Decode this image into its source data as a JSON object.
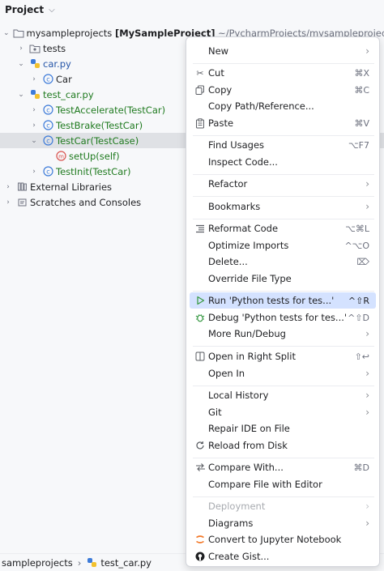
{
  "panel": {
    "title": "Project"
  },
  "tree": {
    "root": {
      "name": "mysampleprojects",
      "module": "[MySampleProject]",
      "path": "~/PycharmProjects/mysampleprojects"
    },
    "tests": "tests",
    "car_py": "car.py",
    "car_class": "Car",
    "test_car_py": "test_car.py",
    "test_accelerate": "TestAccelerate(TestCar)",
    "test_brake": "TestBrake(TestCar)",
    "test_car_case": "TestCar(TestCase)",
    "setup": "setUp(self)",
    "test_init": "TestInit(TestCar)",
    "external_libs": "External Libraries",
    "scratches": "Scratches and Consoles"
  },
  "statusbar": {
    "project": "sampleprojects",
    "file": "test_car.py"
  },
  "menu": {
    "new": "New",
    "cut": "Cut",
    "cut_sc": "⌘X",
    "copy": "Copy",
    "copy_sc": "⌘C",
    "copy_path": "Copy Path/Reference...",
    "paste": "Paste",
    "paste_sc": "⌘V",
    "find_usages": "Find Usages",
    "find_usages_sc": "⌥F7",
    "inspect": "Inspect Code...",
    "refactor": "Refactor",
    "bookmarks": "Bookmarks",
    "reformat": "Reformat Code",
    "reformat_sc": "⌥⌘L",
    "optimize": "Optimize Imports",
    "optimize_sc": "^⌥O",
    "delete": "Delete...",
    "delete_sc": "⌦",
    "override": "Override File Type",
    "run": "Run 'Python tests for tes...'",
    "run_sc": "^⇧R",
    "debug": "Debug 'Python tests for tes...'",
    "debug_sc": "^⇧D",
    "more_run": "More Run/Debug",
    "open_split": "Open in Right Split",
    "open_split_sc": "⇧↩",
    "open_in": "Open In",
    "local_history": "Local History",
    "git": "Git",
    "repair": "Repair IDE on File",
    "reload": "Reload from Disk",
    "compare_with": "Compare With...",
    "compare_with_sc": "⌘D",
    "compare_editor": "Compare File with Editor",
    "deployment": "Deployment",
    "diagrams": "Diagrams",
    "jupyter": "Convert to Jupyter Notebook",
    "gist": "Create Gist..."
  }
}
